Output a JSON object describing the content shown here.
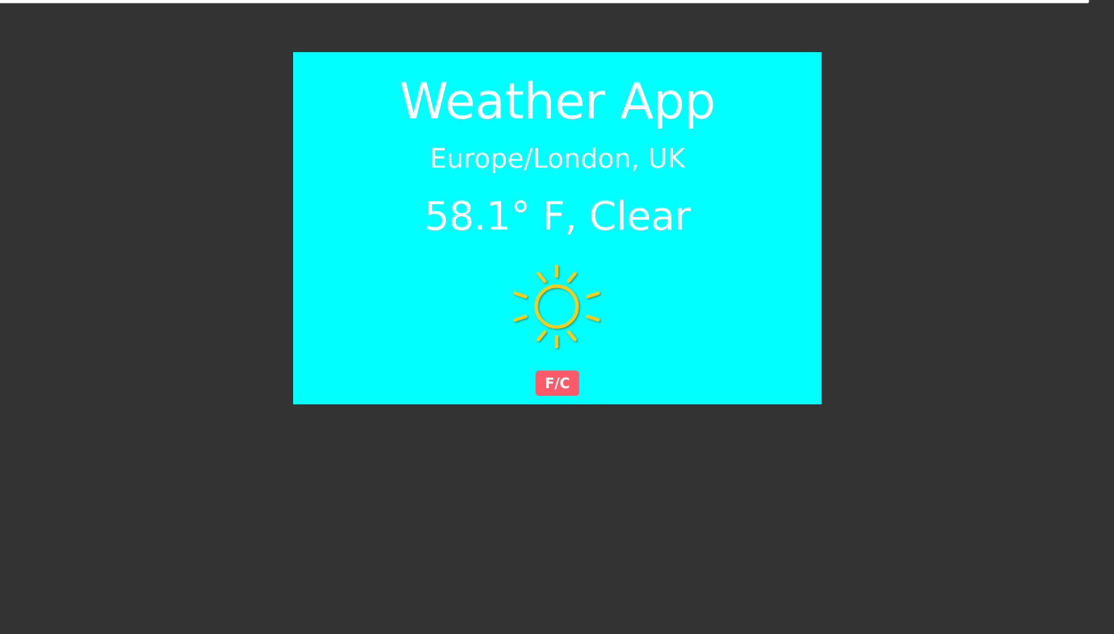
{
  "app": {
    "title": "Weather App"
  },
  "weather": {
    "location": "Europe/London, UK",
    "reading": "58.1° F, Clear",
    "icon": "sun-icon"
  },
  "controls": {
    "unit_toggle_label": "F/C"
  },
  "colors": {
    "page_background": "#333333",
    "card_background": "#00ffff",
    "text": "#ffffff",
    "sun": "#f5cc1e",
    "toggle_background": "#ff5a6a"
  }
}
